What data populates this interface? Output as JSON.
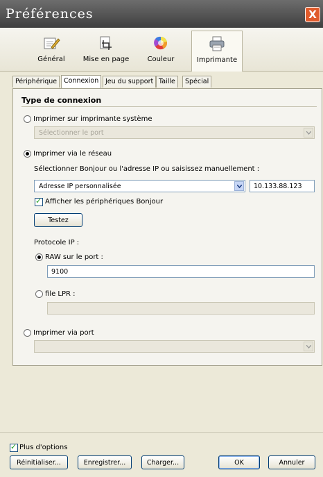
{
  "window": {
    "title": "Préférences",
    "close_label": "X"
  },
  "toolbar": {
    "items": [
      {
        "label": "Général",
        "icon": "pencil-notepad-icon"
      },
      {
        "label": "Mise en page",
        "icon": "crop-icon"
      },
      {
        "label": "Couleur",
        "icon": "color-wheel-icon"
      },
      {
        "label": "Imprimante",
        "icon": "printer-icon"
      }
    ],
    "active": "Imprimante"
  },
  "tabs": [
    "Périphérique",
    "Connexion",
    "Jeu du support",
    "Taille",
    "Spécial"
  ],
  "active_tab": "Connexion",
  "connection": {
    "heading": "Type de connexion",
    "system_printer": {
      "label": "Imprimer sur imprimante système",
      "selected": false,
      "port_placeholder": "Sélectionner le port"
    },
    "network": {
      "label": "Imprimer via le réseau",
      "selected": true,
      "instruction": "Sélectionner Bonjour ou l'adresse IP ou saisissez manuellement :",
      "address_type": "Adresse IP personnalisée",
      "ip_address": "10.133.88.123",
      "show_bonjour_label": "Afficher les périphériques Bonjour",
      "show_bonjour_checked": true,
      "test_button": "Testez",
      "protocol_label": "Protocole IP :",
      "raw": {
        "label": "RAW sur le port :",
        "selected": true,
        "value": "9100"
      },
      "lpr": {
        "label": "file LPR :",
        "selected": false,
        "value": ""
      }
    },
    "port": {
      "label": "Imprimer via port",
      "selected": false,
      "value": ""
    }
  },
  "footer": {
    "more_options_label": "Plus d'options",
    "more_options_checked": true,
    "buttons": {
      "reset": "Réinitialiser...",
      "save": "Enregistrer...",
      "load": "Charger...",
      "ok": "OK",
      "cancel": "Annuler"
    }
  }
}
